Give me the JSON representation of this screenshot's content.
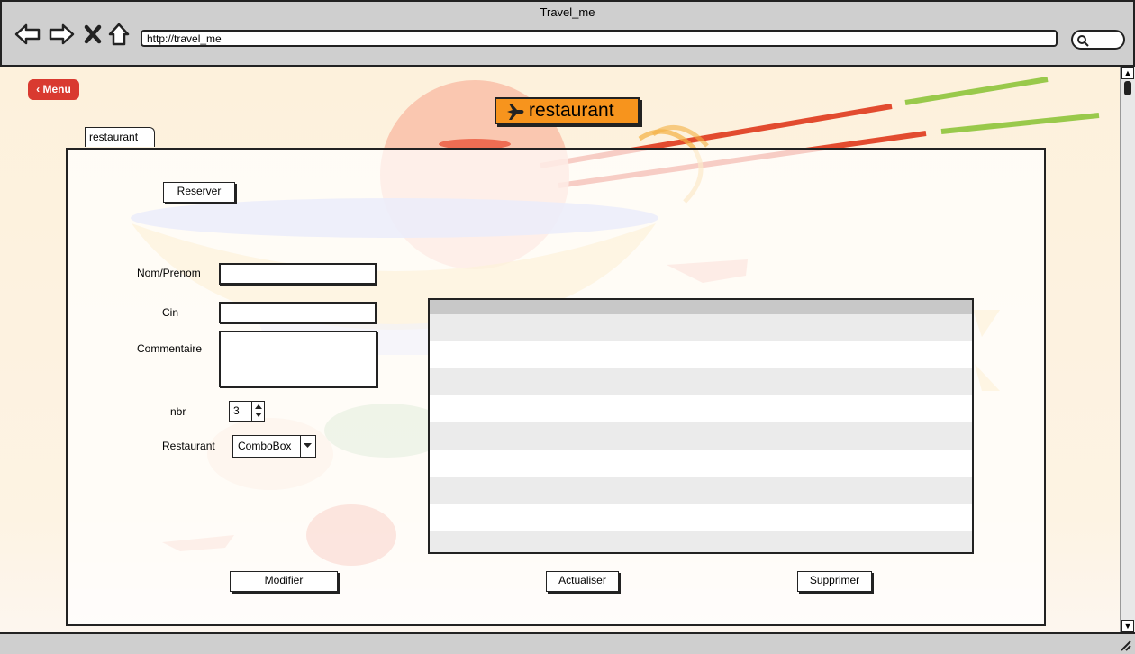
{
  "browser": {
    "window_title": "Travel_me",
    "url": "http://travel_me"
  },
  "page": {
    "menu_label": "Menu",
    "title": "restaurant",
    "tab_label": "restaurant"
  },
  "form": {
    "reserve_label": "Reserver",
    "name_label": "Nom/Prenom",
    "name_value": "",
    "cin_label": "Cin",
    "cin_value": "",
    "comment_label": "Commentaire",
    "comment_value": "",
    "nbr_label": "nbr",
    "nbr_value": "3",
    "restaurant_label": "Restaurant",
    "restaurant_value": "ComboBox"
  },
  "table": {
    "rows": 9
  },
  "actions": {
    "modify_label": "Modifier",
    "refresh_label": "Actualiser",
    "delete_label": "Supprimer"
  },
  "colors": {
    "menu_button": "#d93a30",
    "title_badge": "#f7941d"
  }
}
